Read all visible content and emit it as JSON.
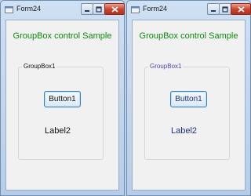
{
  "windows": [
    {
      "title": "Form24",
      "heading": "GroupBox control Sample",
      "group_label": "GroupBox1",
      "button_label": "Button1",
      "label_text": "Label2"
    },
    {
      "title": "Form24",
      "heading": "GroupBox control Sample",
      "group_label": "GroupBox1",
      "button_label": "Button1",
      "label_text": "Label2"
    }
  ],
  "colors": {
    "heading": "#0a8a0a",
    "close_button": "#c8432d",
    "right_group_label": "#5a3fb0",
    "right_text": "#1f2f7a"
  },
  "icons": {
    "title_icon": "form-app-icon",
    "minimize": "minimize-icon",
    "maximize": "maximize-icon",
    "close": "close-icon"
  }
}
